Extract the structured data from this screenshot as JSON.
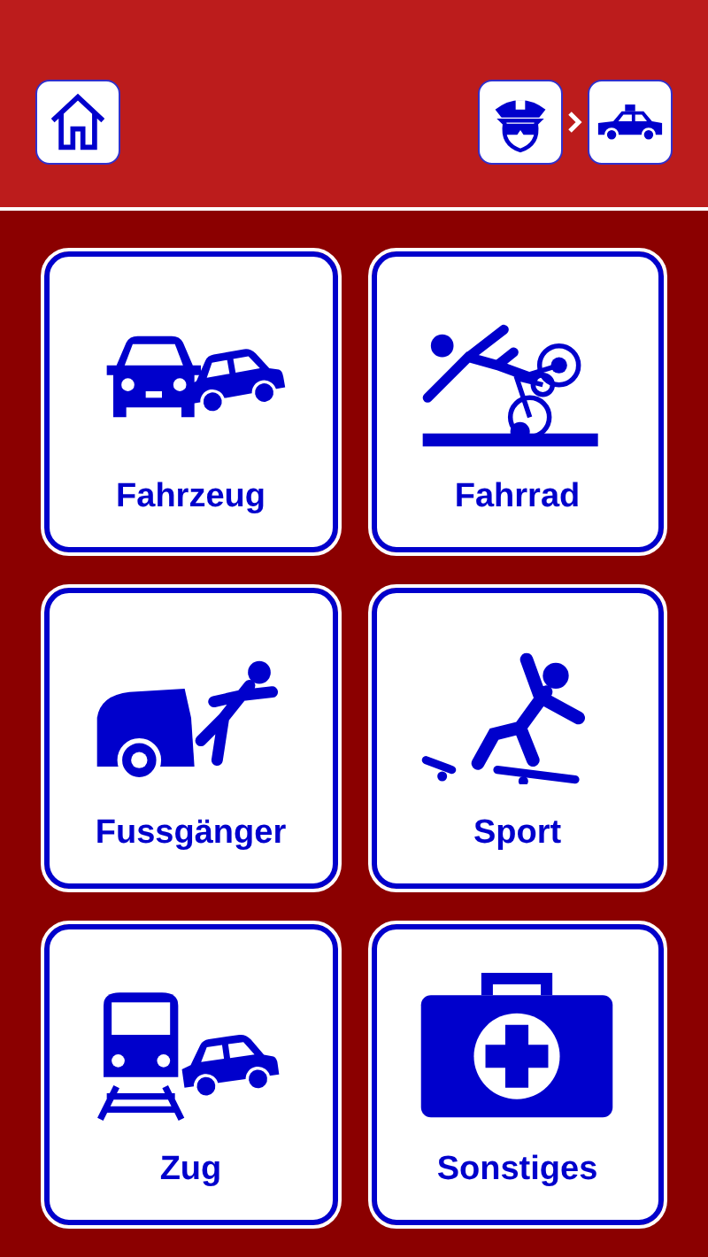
{
  "header": {
    "home_button": {
      "kind": "home"
    },
    "breadcrumb": [
      {
        "kind": "police-officer"
      },
      {
        "kind": "police-car"
      }
    ]
  },
  "tiles": [
    {
      "label": "Fahrzeug",
      "kind": "car-crash"
    },
    {
      "label": "Fahrrad",
      "kind": "bicycle-fall"
    },
    {
      "label": "Fussgänger",
      "kind": "pedestrian"
    },
    {
      "label": "Sport",
      "kind": "skateboard"
    },
    {
      "label": "Zug",
      "kind": "train"
    },
    {
      "label": "Sonstiges",
      "kind": "first-aid"
    }
  ]
}
